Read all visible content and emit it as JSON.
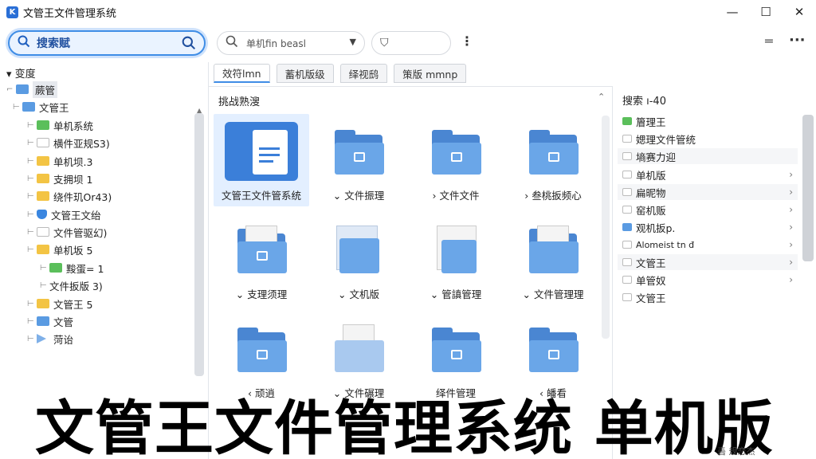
{
  "window": {
    "title": "文管王文件管理系统",
    "minimize": "—",
    "maximize": "☐",
    "close": "✕"
  },
  "toolbar": {
    "search_main": "搜索赋",
    "search_secondary": "单机fin beasl",
    "filter_icon": "⛉"
  },
  "left": {
    "header": "变度",
    "tree": [
      {
        "label": "蕨管",
        "icon": "blue"
      },
      {
        "label": "文管王",
        "icon": "blue"
      },
      {
        "label": "单机系统",
        "icon": "green"
      },
      {
        "label": "横件亚规S3)",
        "icon": "white"
      },
      {
        "label": "单机坝.3",
        "icon": "yellow"
      },
      {
        "label": "支拥坝 1",
        "icon": "yellow"
      },
      {
        "label": "绕件玑Or43)",
        "icon": "yellow"
      },
      {
        "label": "文管王文绐",
        "icon": "shield"
      },
      {
        "label": "文件管驱幻)",
        "icon": "white"
      },
      {
        "label": "单机坂 5",
        "icon": "yellow"
      },
      {
        "label": "黢蛋= 1",
        "icon": "green"
      },
      {
        "label": "文件扳版 3)",
        "icon": "none"
      },
      {
        "label": "文管王 5",
        "icon": "yellow"
      },
      {
        "label": "文管",
        "icon": "blue"
      },
      {
        "label": "菏诒",
        "icon": "tri"
      }
    ]
  },
  "tabs": [
    "效符lmn",
    "蓄机版级",
    "绎视鸱",
    "策版 mmnp"
  ],
  "center": {
    "header": "挑战熟溲",
    "tiles": [
      {
        "caption": "文管王文件管系统",
        "kind": "doc"
      },
      {
        "caption": "文件振理",
        "kind": "folder"
      },
      {
        "caption": "文件文件",
        "kind": "folder"
      },
      {
        "caption": "叁桃扳频心",
        "kind": "folder"
      },
      {
        "caption": "支理须理",
        "kind": "paper"
      },
      {
        "caption": "文机版",
        "kind": "plain"
      },
      {
        "caption": "管謓管理",
        "kind": "paper"
      },
      {
        "caption": "文件管理理",
        "kind": "paper"
      },
      {
        "caption": "顽逍",
        "kind": "folder"
      },
      {
        "caption": "文件碾理",
        "kind": "paper"
      },
      {
        "caption": "绎件管理",
        "kind": "folder"
      },
      {
        "caption": "皤看",
        "kind": "folder"
      }
    ]
  },
  "right": {
    "header": "搜索 ı-40",
    "items": [
      {
        "label": "篃理王",
        "icon": "green",
        "chev": false
      },
      {
        "label": "媤理文件管统",
        "icon": "white",
        "chev": false
      },
      {
        "label": "墒赛力迎",
        "icon": "white",
        "chev": false
      },
      {
        "label": "单机版",
        "icon": "white",
        "chev": true
      },
      {
        "label": "扁昵物",
        "icon": "white",
        "chev": true
      },
      {
        "label": "窑机贩",
        "icon": "white",
        "chev": true
      },
      {
        "label": "观机扳p.",
        "icon": "blue",
        "chev": true
      },
      {
        "label": "Alomeist tn đ",
        "icon": "white",
        "chev": true
      },
      {
        "label": "文管王",
        "icon": "white",
        "chev": true
      },
      {
        "label": "单管奴",
        "icon": "white",
        "chev": true
      },
      {
        "label": "文管王",
        "icon": "white",
        "chev": false
      }
    ]
  },
  "banner": "文管王文件管理系统 单机版",
  "status": "砉 规恋杰"
}
